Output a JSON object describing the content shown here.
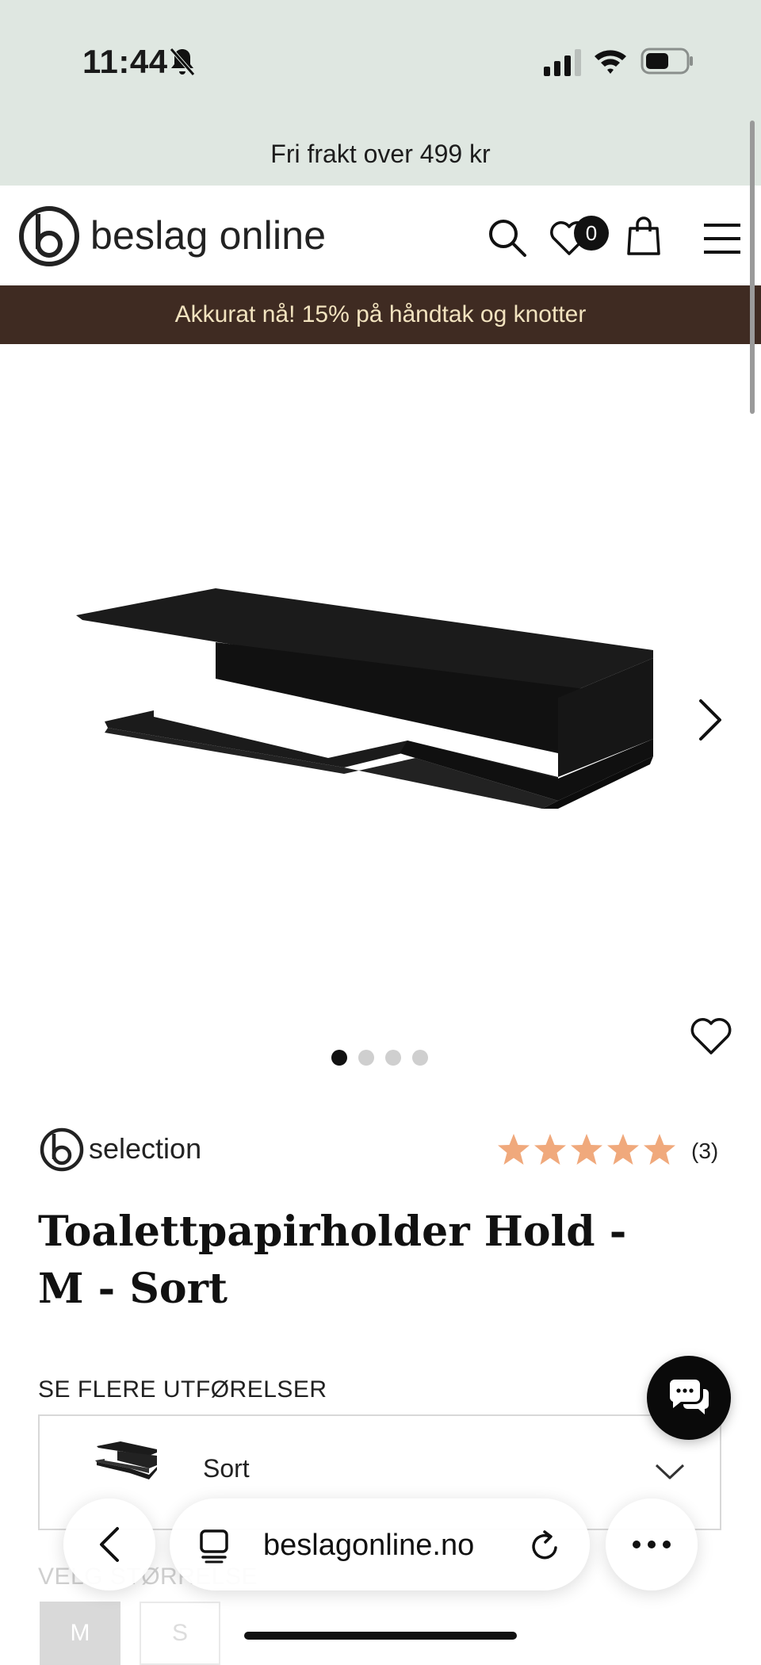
{
  "status_bar": {
    "time": "11:44"
  },
  "free_shipping": "Fri frakt over 499 kr",
  "header": {
    "logo_text": "beslag online",
    "wishlist_count": "0"
  },
  "promo": "Akkurat nå! 15% på håndtak og knotter",
  "gallery": {
    "total_images": 4,
    "active_index": 1
  },
  "product": {
    "brand": "selection",
    "rating": 5,
    "review_count": "(3)",
    "title": "Toalettpapirholder Hold - M - Sort"
  },
  "variants": {
    "label": "SE FLERE UTFØRELSER",
    "selected": "Sort"
  },
  "size": {
    "label": "VELG STØRRELSE",
    "options": [
      "M",
      "S"
    ],
    "selected": "M"
  },
  "browser": {
    "url": "beslagonline.no"
  },
  "colors": {
    "top_bg": "#dfe7e1",
    "promo_bg": "#3f2b22",
    "promo_text": "#f2e3bf",
    "star": "#f0a97c"
  }
}
